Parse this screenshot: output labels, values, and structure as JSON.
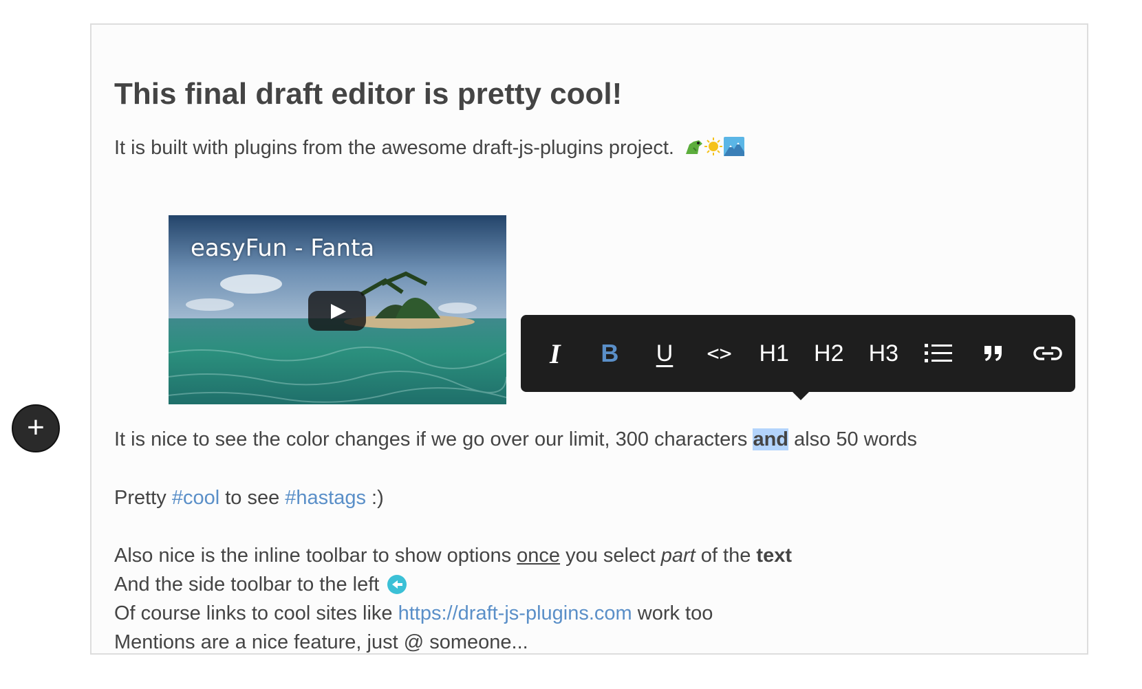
{
  "editor": {
    "title": "This final draft editor is pretty cool!",
    "intro": "It is built with plugins from the awesome draft-js-plugins project.",
    "intro_emoji": [
      "dragon-icon",
      "sun-icon",
      "mountain-icon"
    ],
    "video": {
      "title": "easyFun - Fanta"
    },
    "limit_line": {
      "before": "It is nice to see the color changes if we go over our limit, 300 characters ",
      "selected": "and",
      "after": " also 50 words"
    },
    "hashtag_line": {
      "t1": "Pretty ",
      "tag1": "#cool",
      "t2": " to see ",
      "tag2": "#hastags",
      "t3": " :)"
    },
    "inline_line": {
      "t1": "Also nice is the inline toolbar to show options ",
      "underline": "once",
      "t2": " you select ",
      "italic": "part",
      "t3": " of the ",
      "bold": "text"
    },
    "side_line": "And the side toolbar to the left",
    "link_line": {
      "t1": "Of course links to cool sites like ",
      "link": "https://draft-js-plugins.com",
      "t2": " work too"
    },
    "mentions_line": "Mentions are a nice feature, just @ someone..."
  },
  "toolbar": {
    "buttons": [
      {
        "name": "italic",
        "label": "I"
      },
      {
        "name": "bold",
        "label": "B",
        "active": true
      },
      {
        "name": "underline",
        "label": "U"
      },
      {
        "name": "code",
        "label": "<>"
      },
      {
        "name": "h1",
        "label": "H1"
      },
      {
        "name": "h2",
        "label": "H2"
      },
      {
        "name": "h3",
        "label": "H3"
      },
      {
        "name": "list",
        "label": "list-icon"
      },
      {
        "name": "blockquote",
        "label": "quote-icon"
      },
      {
        "name": "link",
        "label": "link-icon"
      }
    ]
  },
  "side_toolbar": {
    "plus_label": "+"
  },
  "colors": {
    "accent": "#5a8fc8",
    "selection": "#b3d4fc",
    "toolbar_bg": "#1e1e1e",
    "arrow_icon": "#3bc0d6"
  }
}
